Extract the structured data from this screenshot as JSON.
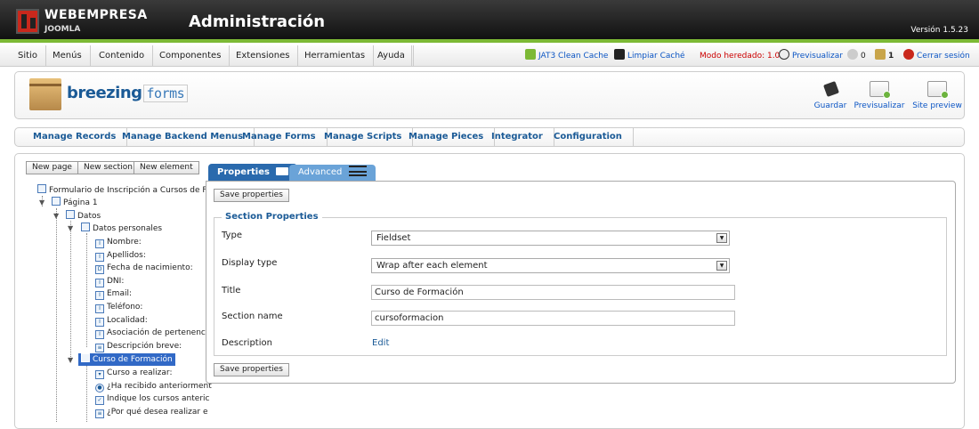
{
  "topbar": {
    "brand": "WEBEMPRESA",
    "brand_sub": "JOOMLA",
    "title": "Administración",
    "version": "Versión 1.5.23"
  },
  "menu": {
    "items": [
      "Sitio",
      "Menús",
      "Contenido",
      "Componentes",
      "Extensiones",
      "Herramientas",
      "Ayuda"
    ],
    "jat3": "JAT3 Clean Cache",
    "clear_cache": "Limpiar Caché",
    "mode": "Modo heredado: 1.0",
    "preview": "Previsualizar",
    "messages": "0",
    "users": "1",
    "logout": "Cerrar sesión"
  },
  "header": {
    "logo_bold": "breezing",
    "logo_light": "forms",
    "buttons": [
      "Guardar",
      "Previsualizar",
      "Site preview"
    ]
  },
  "nav": {
    "items": [
      "Manage Records",
      "Manage Backend Menus",
      "Manage Forms",
      "Manage Scripts",
      "Manage Pieces",
      "Integrator",
      "Configuration"
    ]
  },
  "tree_toolbar": {
    "new_page": "New page",
    "new_section": "New section",
    "new_element": "New element"
  },
  "tree": {
    "form": "Formulario de Inscripción a Cursos de For",
    "page": "Página 1",
    "datos": "Datos",
    "datos_personales": "Datos personales",
    "fields1": [
      "Nombre:",
      "Apellidos:",
      "Fecha de nacimiento:",
      "DNI:",
      "Email:",
      "Teléfono:",
      "Localidad:",
      "Asociación de pertenenc",
      "Descripción breve:"
    ],
    "curso": "Curso de Formación",
    "fields2": [
      "Curso a realizar:",
      "¿Ha recibido anteriorment",
      "Indique los cursos anteric",
      "¿Por qué desea realizar e"
    ]
  },
  "tabs": {
    "properties": "Properties",
    "advanced": "Advanced"
  },
  "properties": {
    "save": "Save properties",
    "legend": "Section Properties",
    "type_label": "Type",
    "type_value": "Fieldset",
    "display_label": "Display type",
    "display_value": "Wrap after each element",
    "title_label": "Title",
    "title_value": "Curso de Formación",
    "name_label": "Section name",
    "name_value": "cursoformacion",
    "desc_label": "Description",
    "desc_link": "Edit"
  },
  "colors": {
    "accent_green": "#7cb935",
    "link_blue": "#1a5a96",
    "tab_active": "#2a6aad",
    "tab_inactive": "#5b9bd5",
    "selected": "#3169c6"
  }
}
